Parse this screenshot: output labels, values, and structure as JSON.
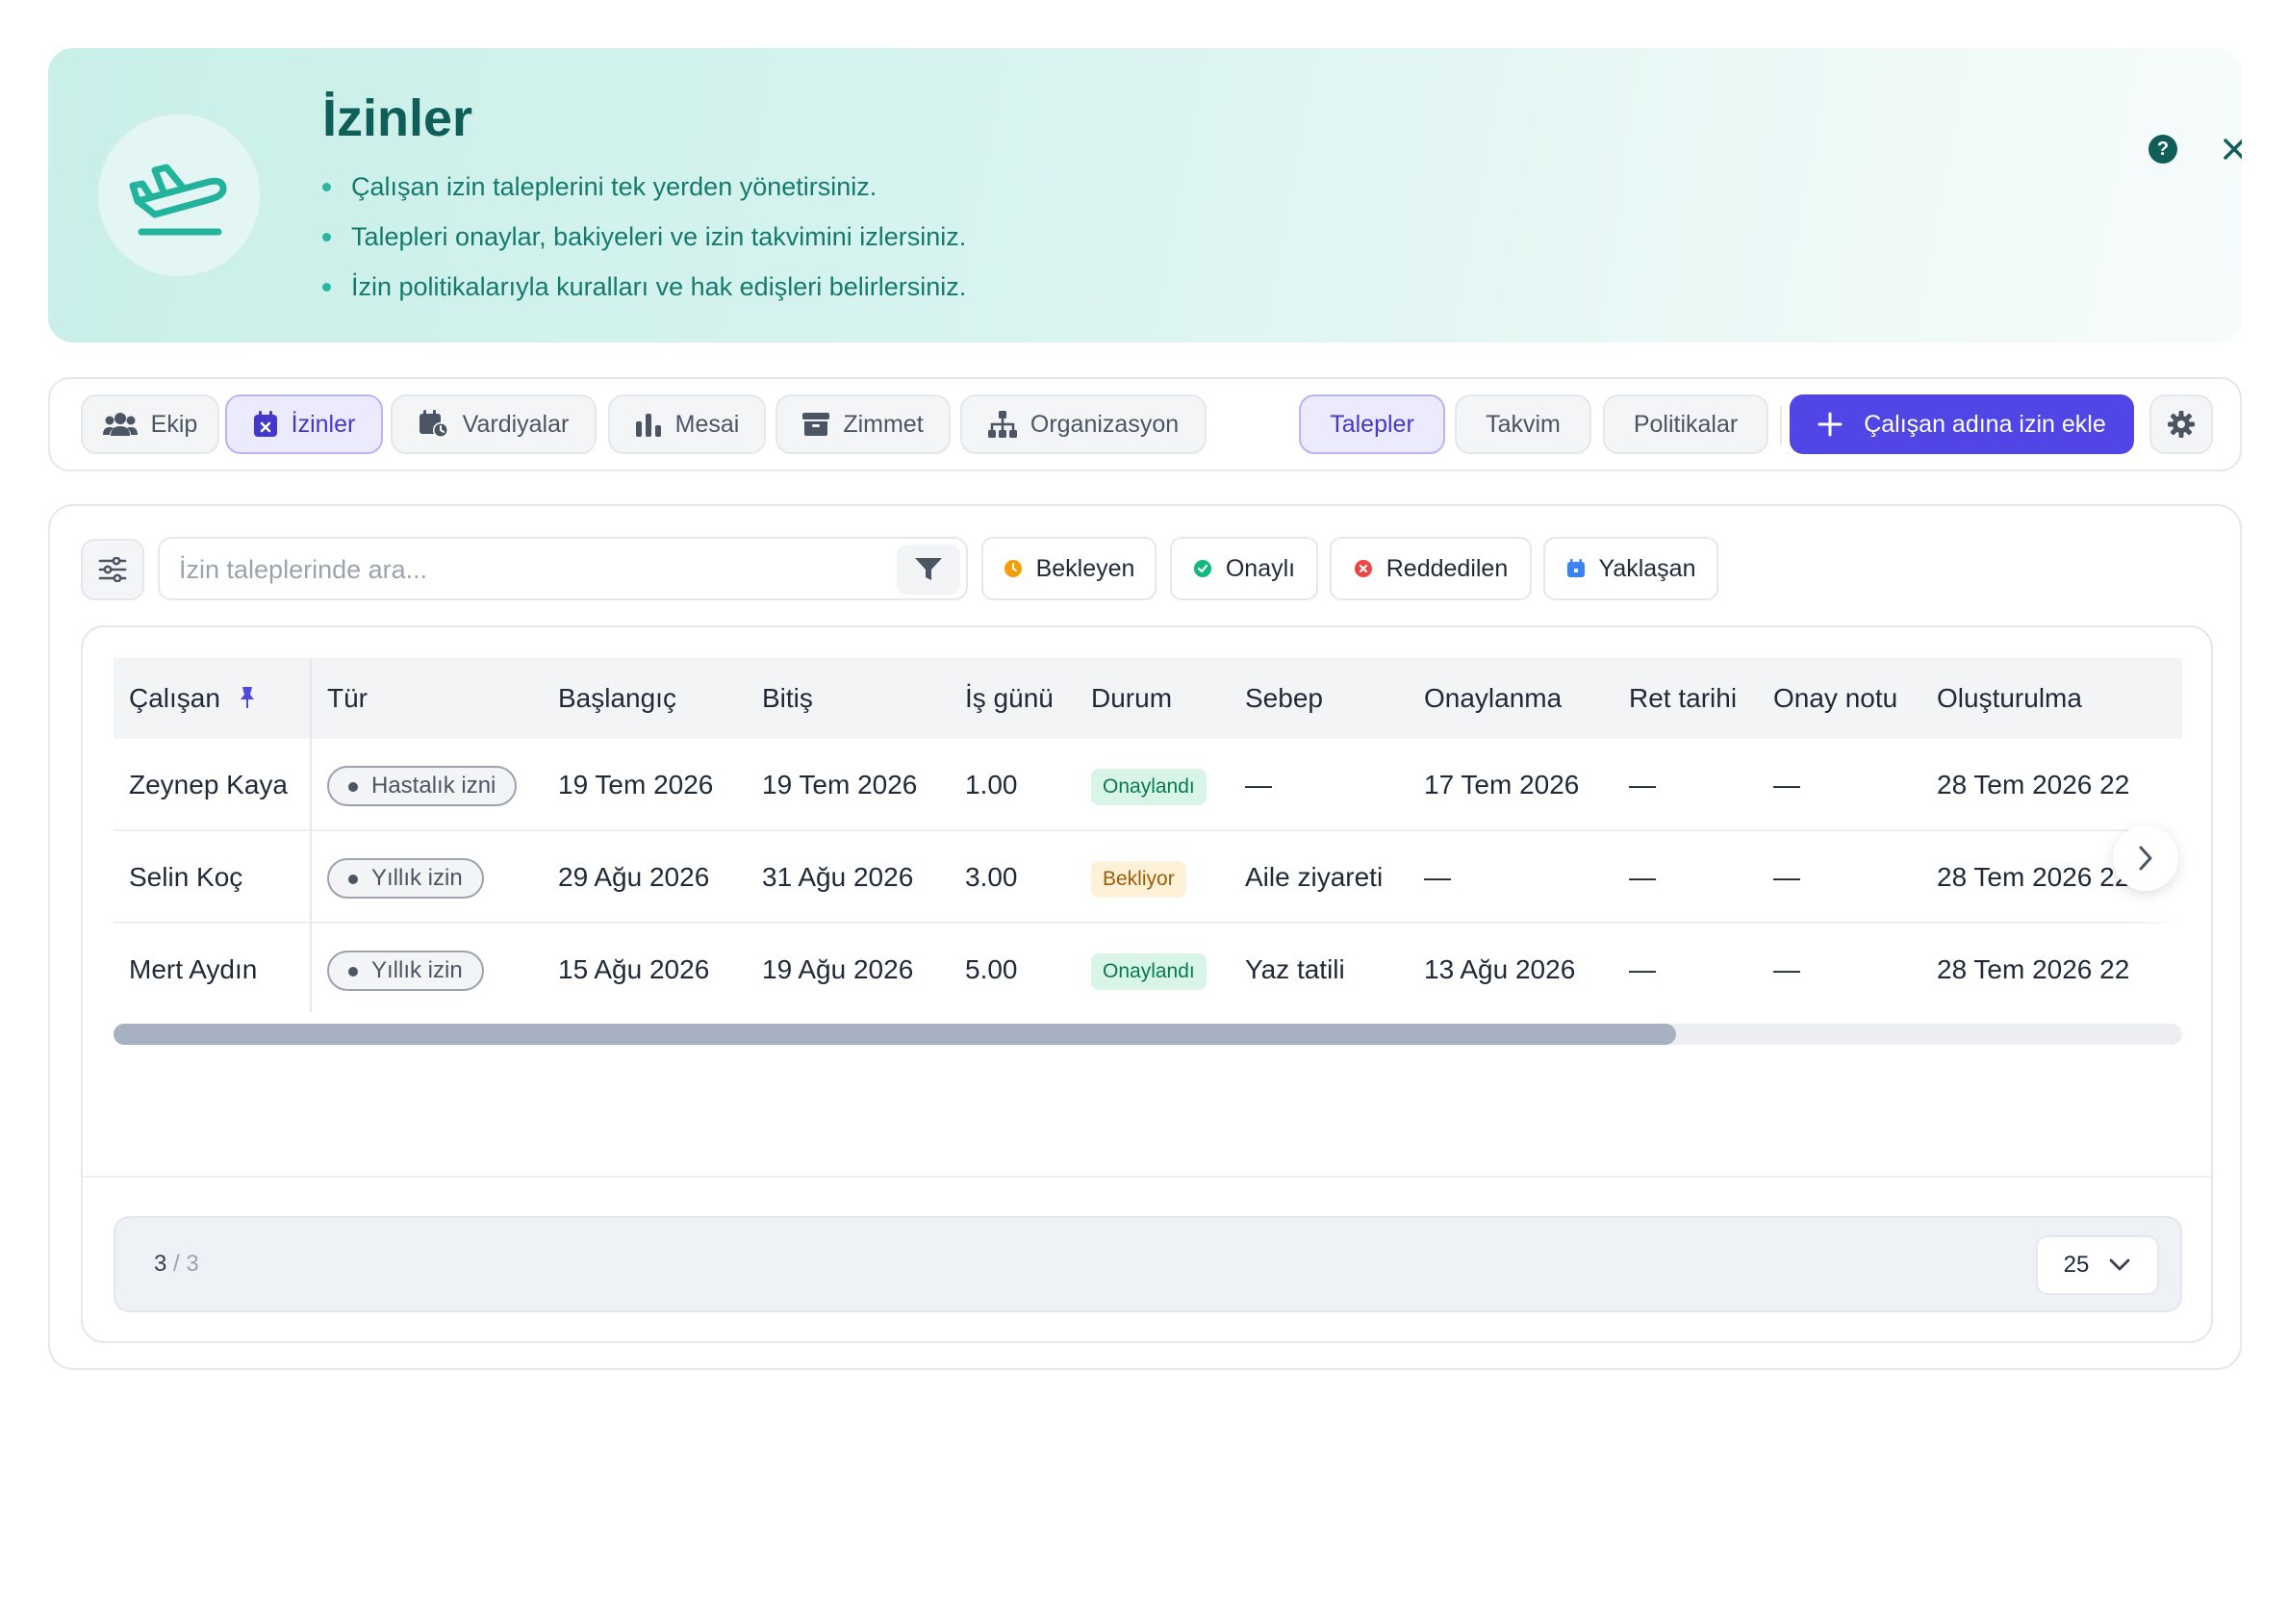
{
  "hero": {
    "title": "İzinler",
    "bullets": [
      "Çalışan izin taleplerini tek yerden yönetirsiniz.",
      "Talepleri onaylar, bakiyeleri ve izin takvimini izlersiniz.",
      "İzin politikalarıyla kuralları ve hak edişleri belirlersiniz."
    ],
    "help_label": "?",
    "icon": "plane-departure-icon"
  },
  "nav": {
    "tabs": [
      {
        "label": "Ekip",
        "icon": "users-icon"
      },
      {
        "label": "İzinler",
        "icon": "calendar-x-icon",
        "active": true
      },
      {
        "label": "Vardiyalar",
        "icon": "calendar-clock-icon"
      },
      {
        "label": "Mesai",
        "icon": "bar-chart-icon"
      },
      {
        "label": "Zimmet",
        "icon": "archive-box-icon"
      },
      {
        "label": "Organizasyon",
        "icon": "org-chart-icon"
      }
    ],
    "views": [
      {
        "label": "Talepler",
        "active": true
      },
      {
        "label": "Takvim"
      },
      {
        "label": "Politikalar"
      }
    ],
    "add_button": "Çalışan adına izin ekle"
  },
  "filters": {
    "search_placeholder": "İzin taleplerinde ara...",
    "chips": [
      {
        "label": "Bekleyen",
        "color": "#f59e0b"
      },
      {
        "label": "Onaylı",
        "color": "#10b981"
      },
      {
        "label": "Reddedilen",
        "color": "#ef4444"
      },
      {
        "label": "Yaklaşan",
        "color": "#3b82f6"
      }
    ]
  },
  "table": {
    "columns": [
      "Çalışan",
      "Tür",
      "Başlangıç",
      "Bitiş",
      "İş günü",
      "Durum",
      "Sebep",
      "Onaylanma",
      "Ret tarihi",
      "Onay notu",
      "Oluşturulma"
    ],
    "rows": [
      {
        "employee": "Zeynep Kaya",
        "type": "Hastalık izni",
        "start": "19 Tem 2026",
        "end": "19 Tem 2026",
        "days": "1.00",
        "status": "Onaylandı",
        "status_kind": "ok",
        "reason": "—",
        "approved": "17 Tem 2026",
        "rejected": "—",
        "note": "—",
        "created": "28 Tem 2026 22"
      },
      {
        "employee": "Selin Koç",
        "type": "Yıllık izin",
        "start": "29 Ağu 2026",
        "end": "31 Ağu 2026",
        "days": "3.00",
        "status": "Bekliyor",
        "status_kind": "wait",
        "reason": "Aile ziyareti",
        "approved": "—",
        "rejected": "—",
        "note": "—",
        "created": "28 Tem 2026 22"
      },
      {
        "employee": "Mert Aydın",
        "type": "Yıllık izin",
        "start": "15 Ağu 2026",
        "end": "19 Ağu 2026",
        "days": "5.00",
        "status": "Onaylandı",
        "status_kind": "ok",
        "reason": "Yaz tatili",
        "approved": "13 Ağu 2026",
        "rejected": "—",
        "note": "—",
        "created": "28 Tem 2026 22"
      }
    ]
  },
  "pager": {
    "shown": "3",
    "separator": "/",
    "total": "3",
    "page_size": "25"
  },
  "colors": {
    "brand": "#4f46e5",
    "teal": "#0f5e57"
  }
}
